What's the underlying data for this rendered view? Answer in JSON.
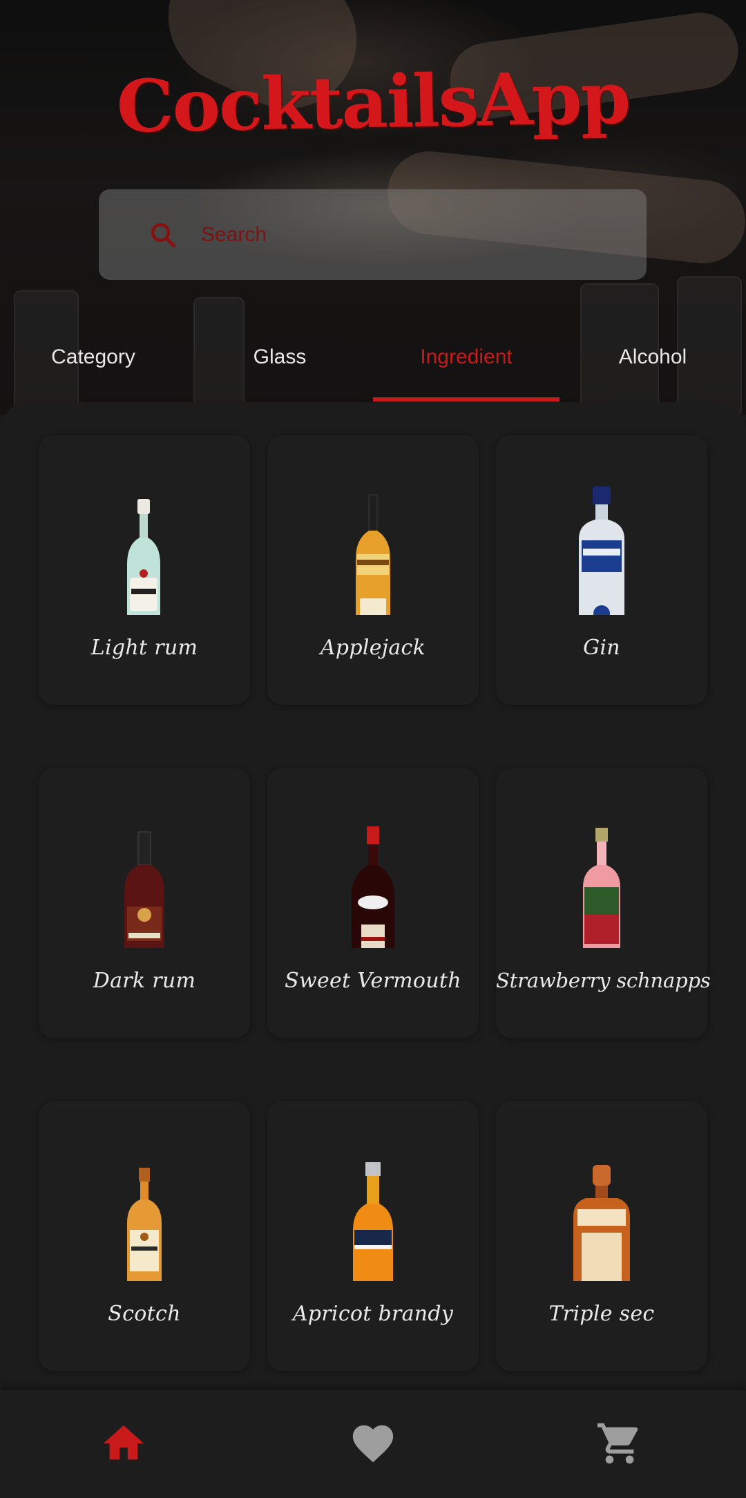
{
  "app": {
    "title": "CocktailsApp"
  },
  "search": {
    "placeholder": "Search"
  },
  "tabs": [
    {
      "label": "Category",
      "active": false
    },
    {
      "label": "Glass",
      "active": false
    },
    {
      "label": "Ingredient",
      "active": true
    },
    {
      "label": "Alcohol",
      "active": false
    }
  ],
  "ingredients": [
    {
      "name": "Light rum",
      "bottle_icon": "clear-rum-bottle-icon"
    },
    {
      "name": "Applejack",
      "bottle_icon": "amber-bottle-icon"
    },
    {
      "name": "Gin",
      "bottle_icon": "clear-gin-bottle-icon"
    },
    {
      "name": "Dark rum",
      "bottle_icon": "dark-red-bottle-icon"
    },
    {
      "name": "Sweet Vermouth",
      "bottle_icon": "dark-vermouth-bottle-icon"
    },
    {
      "name": "Strawberry schnapps",
      "bottle_icon": "pink-bottle-icon"
    },
    {
      "name": "Scotch",
      "bottle_icon": "whisky-bottle-icon"
    },
    {
      "name": "Apricot brandy",
      "bottle_icon": "orange-bottle-icon"
    },
    {
      "name": "Triple sec",
      "bottle_icon": "square-orange-bottle-icon"
    }
  ],
  "nav": [
    {
      "icon": "home-icon",
      "active": true
    },
    {
      "icon": "heart-icon",
      "active": false
    },
    {
      "icon": "cart-icon",
      "active": false
    }
  ],
  "colors": {
    "accent": "#c8191b",
    "background": "#1a1a1a",
    "card": "#1e1e1e",
    "inactive_icon": "#9e9e9e"
  }
}
